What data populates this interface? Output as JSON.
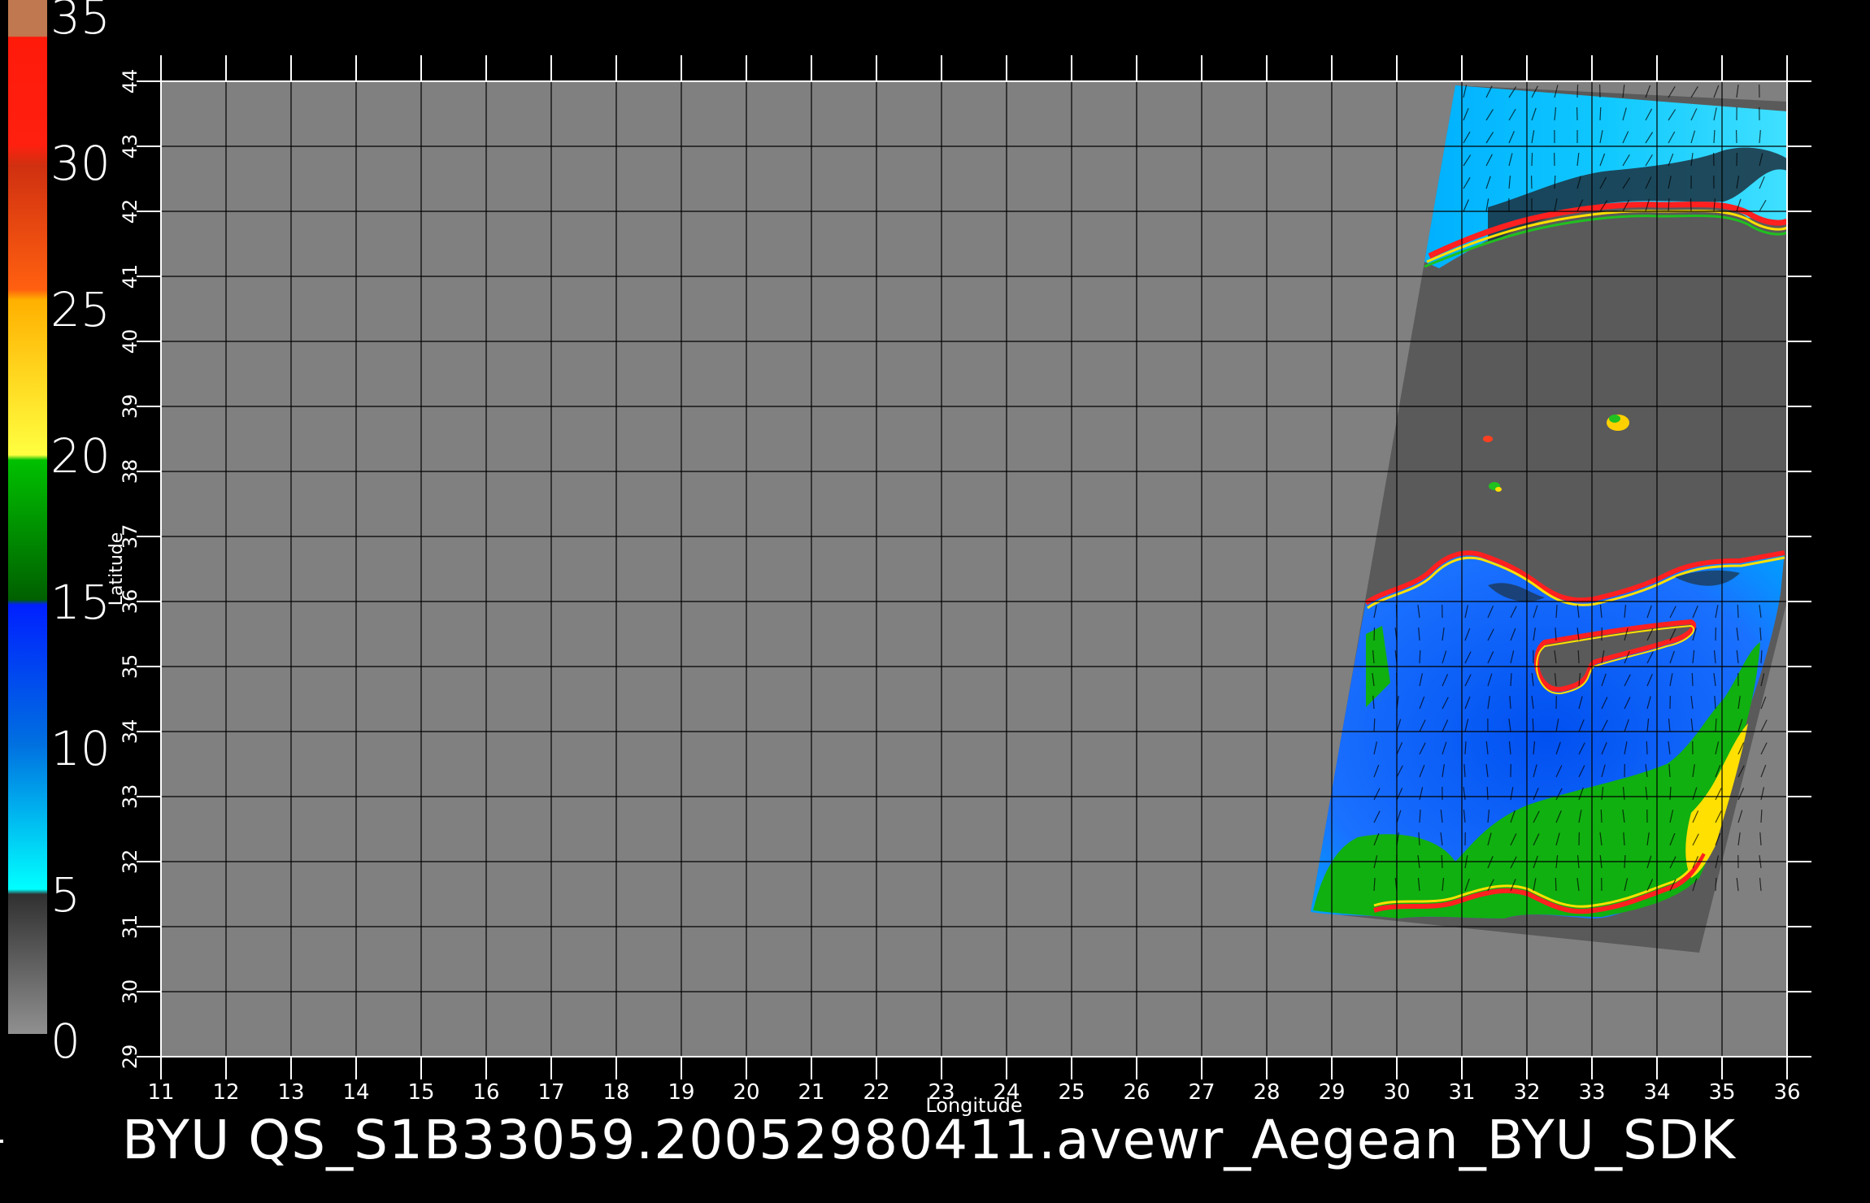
{
  "colorbar": {
    "labels": [
      "35",
      "30",
      "25",
      "20",
      "15",
      "10",
      "5",
      "0"
    ],
    "segments": [
      {
        "color": "#c07850",
        "from": 35,
        "to": 33.3
      },
      {
        "color": "#ff1a0a",
        "from": 33.3,
        "to": 30
      },
      {
        "color": "#e85010",
        "from": 30,
        "to": 25
      },
      {
        "color": "#ffd000",
        "from": 25,
        "to": 20
      },
      {
        "color": "#00a000",
        "from": 20,
        "to": 15
      },
      {
        "color": "#0050ff",
        "from": 15,
        "to": 10
      },
      {
        "color": "#00e8ff",
        "from": 10,
        "to": 5
      },
      {
        "color": "#555555",
        "from": 5,
        "to": 0
      }
    ]
  },
  "map": {
    "lon_range": [
      11,
      36
    ],
    "lat_range": [
      29,
      44
    ],
    "lon_ticks": [
      "11",
      "12",
      "13",
      "14",
      "15",
      "16",
      "17",
      "18",
      "19",
      "20",
      "21",
      "22",
      "23",
      "24",
      "25",
      "26",
      "27",
      "28",
      "29",
      "30",
      "31",
      "32",
      "33",
      "34",
      "35",
      "36"
    ],
    "lat_ticks": [
      "29",
      "30",
      "31",
      "32",
      "33",
      "34",
      "35",
      "36",
      "37",
      "38",
      "39",
      "40",
      "41",
      "42",
      "43",
      "44"
    ],
    "xlabel": "Longitude",
    "ylabel": "Latitude",
    "background_color": "#808080",
    "swath_color": "#5a5a5a"
  },
  "footer": {
    "title": "BYU  QS_S1B33059.20052980411.avewr_Aegean_BYU_SDK"
  }
}
